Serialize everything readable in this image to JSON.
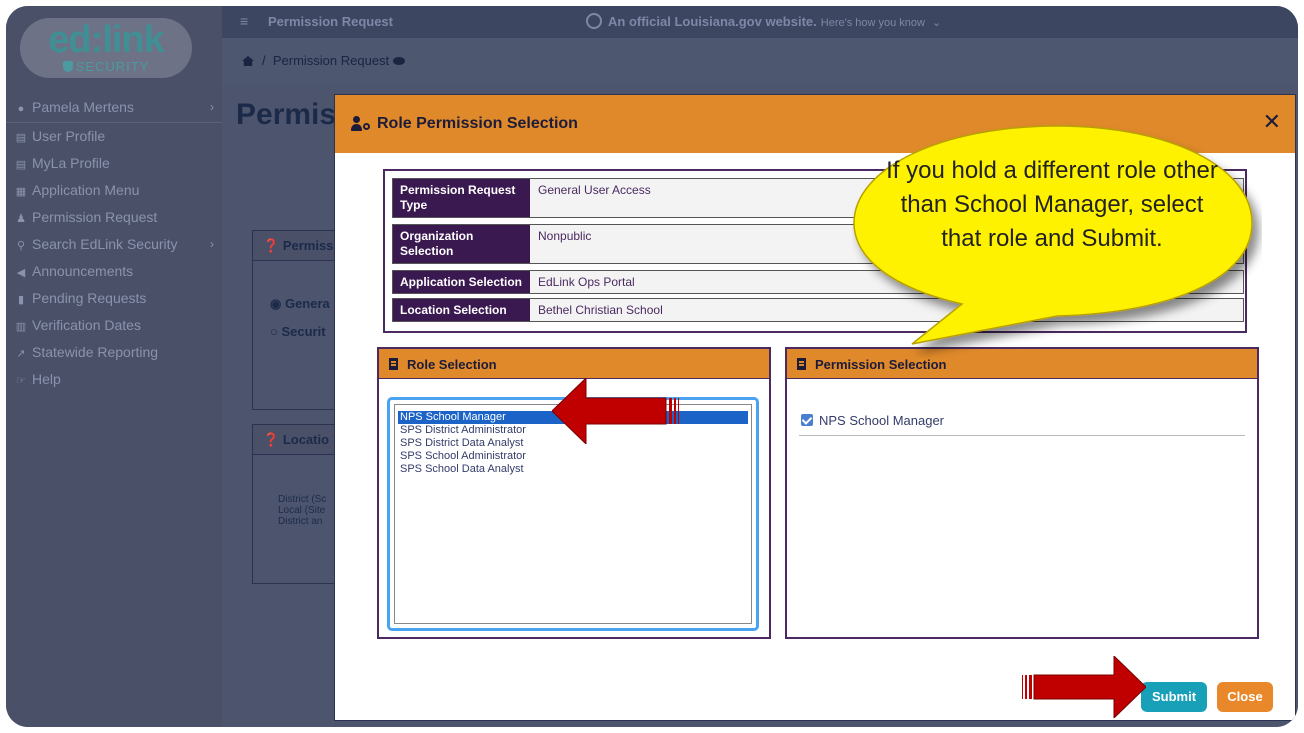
{
  "app": {
    "logo_text": "ed:link",
    "logo_sub": "SECURITY"
  },
  "sidebar": {
    "user": {
      "label": "Pamela Mertens",
      "icon": "user-circle-icon"
    },
    "items": [
      {
        "label": "User Profile",
        "icon": "id-card-icon"
      },
      {
        "label": "MyLa Profile",
        "icon": "id-card-icon"
      },
      {
        "label": "Application Menu",
        "icon": "app-menu-icon"
      },
      {
        "label": "Permission Request",
        "icon": "user-key-icon"
      },
      {
        "label": "Search EdLink Security",
        "icon": "search-icon",
        "has_submenu": true
      },
      {
        "label": "Announcements",
        "icon": "megaphone-icon"
      },
      {
        "label": "Pending Requests",
        "icon": "clipboard-icon"
      },
      {
        "label": "Verification Dates",
        "icon": "calendar-icon"
      },
      {
        "label": "Statewide Reporting",
        "icon": "chart-icon"
      },
      {
        "label": "Help",
        "icon": "hand-icon"
      }
    ]
  },
  "topbar": {
    "title": "Permission Request",
    "gov_banner": "An official Louisiana.gov website.",
    "gov_how": "Here's how you know"
  },
  "breadcrumb": {
    "current": "Permission Request"
  },
  "page": {
    "title": "Permis",
    "bg_card_1": "Permiss",
    "bg_radio_1": "Genera",
    "bg_radio_2": "Securit",
    "bg_card_2": "Locatio",
    "bg_list": [
      "District (Sc",
      "Local (Site",
      "District an"
    ]
  },
  "modal": {
    "title": "Role Permission Selection",
    "summary": [
      {
        "label": "Permission Request Type",
        "value": "General User Access"
      },
      {
        "label": "Organization Selection",
        "value": "Nonpublic"
      },
      {
        "label": "Application Selection",
        "value": "EdLink Ops Portal"
      },
      {
        "label": "Location Selection",
        "value": "Bethel Christian School"
      }
    ],
    "role_panel_title": "Role Selection",
    "roles": [
      "NPS School Manager",
      "SPS District Administrator",
      "SPS District Data Analyst",
      "SPS School Administrator",
      "SPS School Data Analyst"
    ],
    "selected_role": "NPS School Manager",
    "perm_panel_title": "Permission Selection",
    "permissions": [
      {
        "label": "NPS School Manager",
        "checked": true
      }
    ],
    "submit_label": "Submit",
    "close_label": "Close"
  },
  "callout": {
    "text": "If you hold a different role other than School Manager, select that role and Submit."
  },
  "colors": {
    "accent": "#e0892a",
    "header_purple": "#3a1850",
    "submit": "#17a0b8",
    "callout": "#fff200",
    "arrow": "#c00000"
  }
}
